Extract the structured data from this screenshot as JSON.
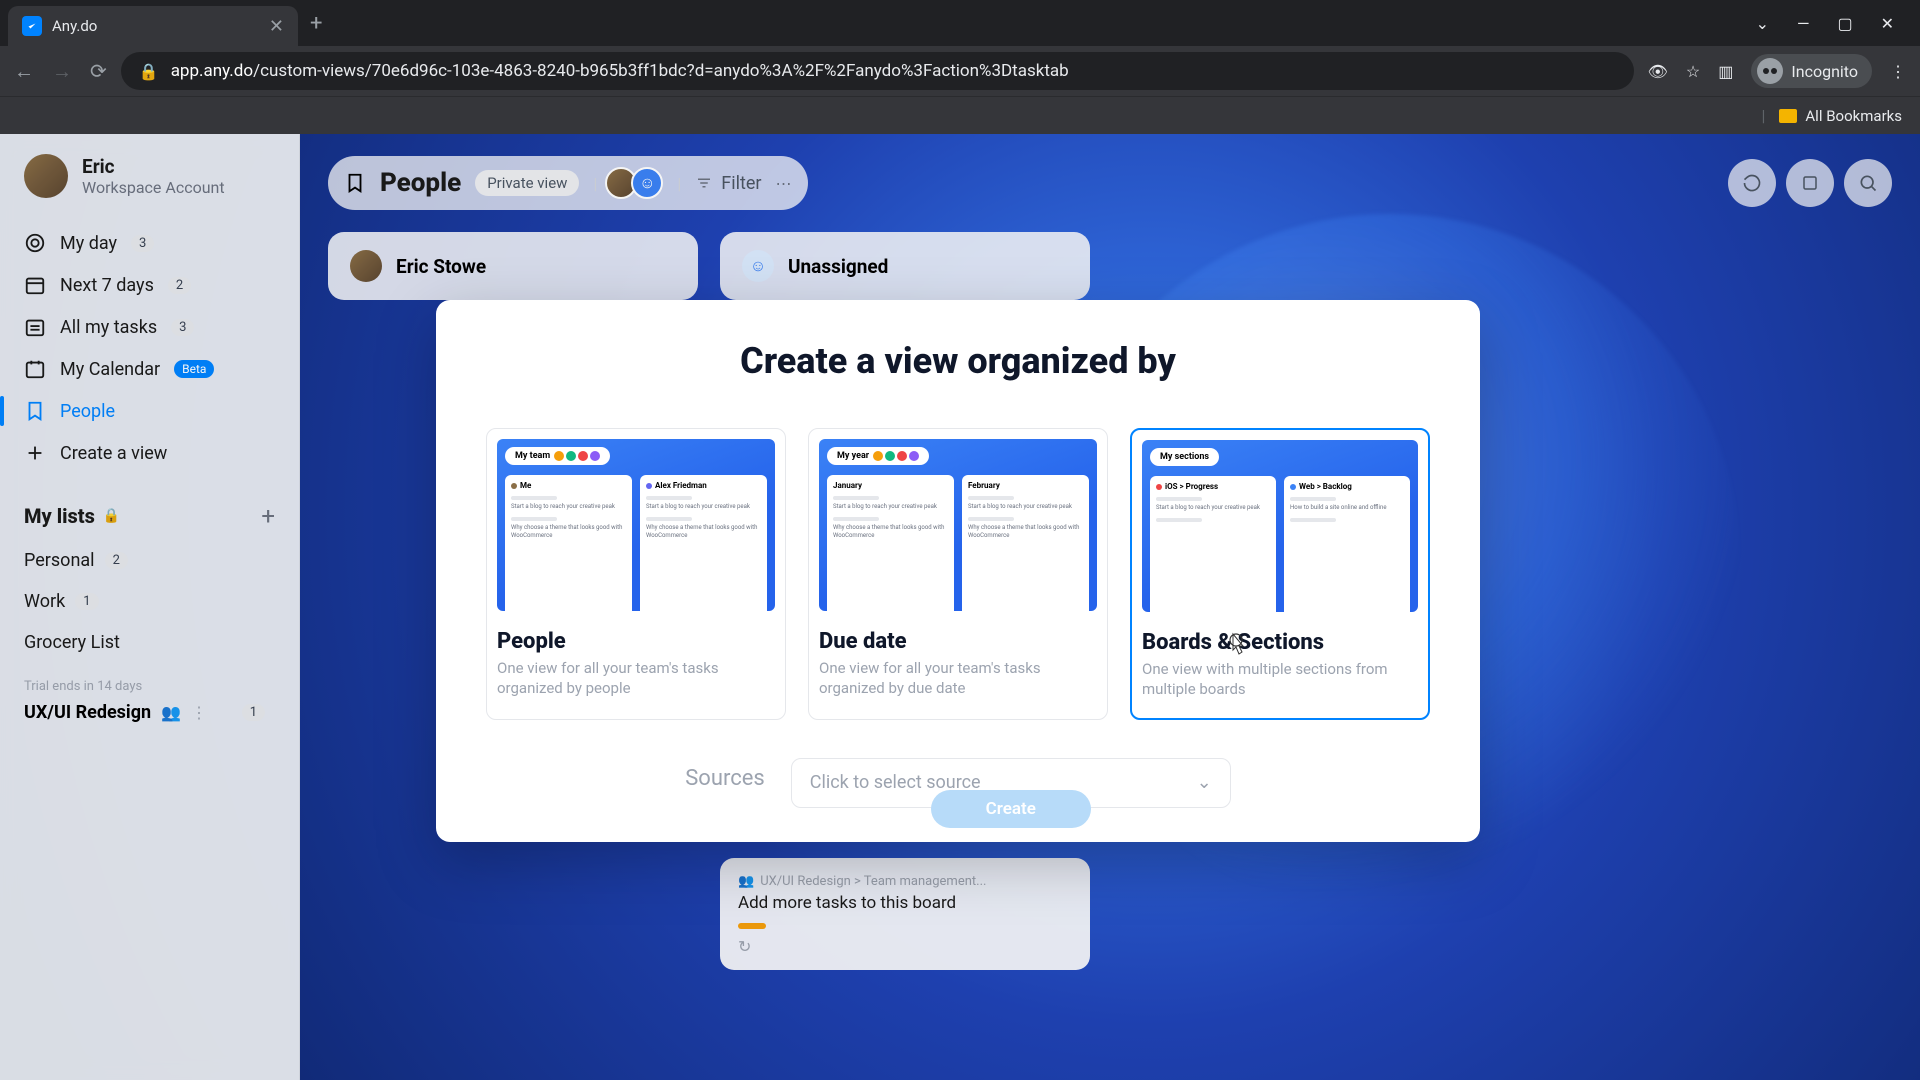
{
  "browser": {
    "tab_title": "Any.do",
    "url_host": "app.any.do",
    "url_path": "/custom-views/70e6d96c-103e-4863-8240-b965b3ff1bdc?d=anydo%3A%2F%2Fanydo%3Faction%3Dtasktab",
    "incognito_label": "Incognito",
    "bookmarks_label": "All Bookmarks"
  },
  "user": {
    "name": "Eric",
    "subtitle": "Workspace Account"
  },
  "nav": {
    "my_day": "My day",
    "my_day_count": "3",
    "next7": "Next 7 days",
    "next7_count": "2",
    "all_tasks": "All my tasks",
    "all_tasks_count": "3",
    "calendar": "My Calendar",
    "calendar_badge": "Beta",
    "people": "People",
    "create_view": "Create a view"
  },
  "lists": {
    "header": "My lists",
    "items": [
      {
        "label": "Personal",
        "count": "2"
      },
      {
        "label": "Work",
        "count": "1"
      },
      {
        "label": "Grocery List",
        "count": ""
      }
    ],
    "trial": "Trial ends in 14 days",
    "project": "UX/UI Redesign",
    "project_count": "1"
  },
  "toolbar": {
    "title": "People",
    "tag": "Private view",
    "filter": "Filter"
  },
  "columns": [
    {
      "name": "Eric Stowe"
    },
    {
      "name": "Unassigned"
    }
  ],
  "task": {
    "crumb": "UX/UI Redesign > Team management...",
    "title": "Add more tasks to this board"
  },
  "modal": {
    "title": "Create a view organized by",
    "sources_label": "Sources",
    "source_placeholder": "Click to select source",
    "create_label": "Create",
    "options": [
      {
        "title": "People",
        "desc": "One view for all your team's tasks organized by people",
        "preview_label": "My team",
        "col1": "Me",
        "col2": "Alex Friedman"
      },
      {
        "title": "Due date",
        "desc": "One view for all your team's tasks organized by due date",
        "preview_label": "My year",
        "col1": "January",
        "col2": "February"
      },
      {
        "title": "Boards & Sections",
        "desc": "One view with multiple sections from multiple boards",
        "preview_label": "My sections",
        "col1": "iOS > Progress",
        "col2": "Web > Backlog"
      }
    ]
  }
}
